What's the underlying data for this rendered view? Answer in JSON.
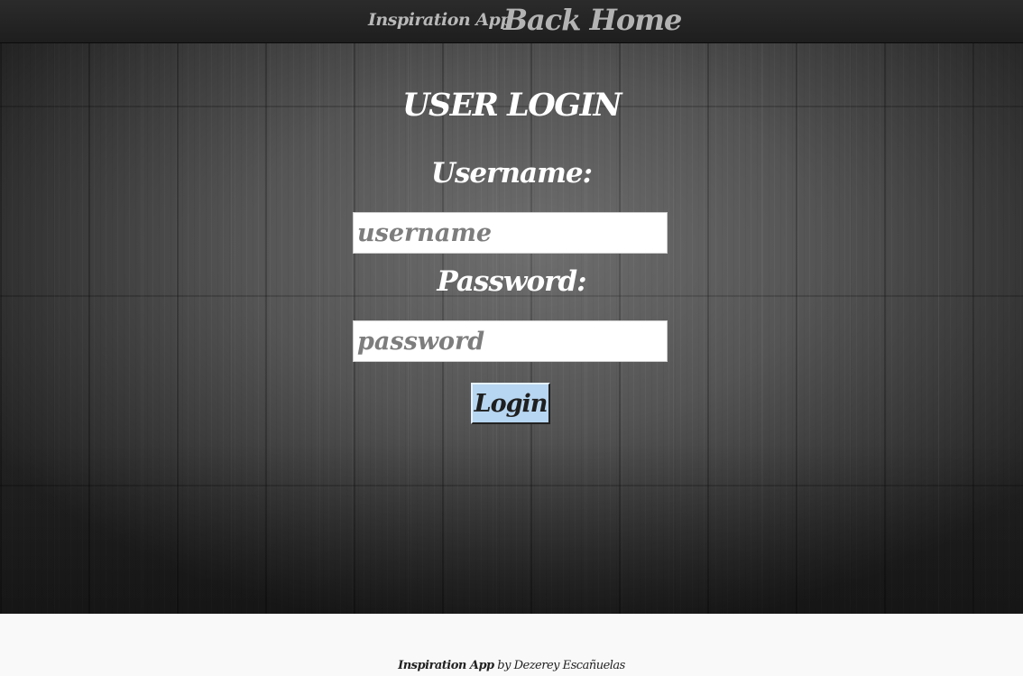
{
  "navbar": {
    "brand": "Inspiration App",
    "links": [
      {
        "label": "Back Home"
      }
    ]
  },
  "login": {
    "title": "USER LOGIN",
    "username_label": "Username:",
    "username_placeholder": "username",
    "username_value": "",
    "password_label": "Password:",
    "password_placeholder": "password",
    "password_value": "",
    "submit_label": "Login"
  },
  "footer": {
    "brand": "Inspiration App",
    "byline": " by Dezerey Escañuelas"
  },
  "colors": {
    "navbar_bg": "#222222",
    "button_bg": "#b7d6f1",
    "text_light": "#ffffff",
    "footer_bg": "#f9f9f9"
  },
  "icons": []
}
